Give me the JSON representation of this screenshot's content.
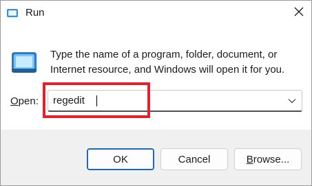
{
  "window": {
    "title": "Run",
    "close_icon": "close-icon",
    "app_icon": "run-icon"
  },
  "description": {
    "line1": "Type the name of a program, folder, document, or",
    "line2": "Internet resource, and Windows will open it for you."
  },
  "open_field": {
    "label_accesskey": "O",
    "label_rest": "pen:",
    "value": "regedit",
    "dropdown_icon": "chevron-down-icon"
  },
  "highlight": {
    "color": "#e5202b"
  },
  "buttons": {
    "ok_label": "OK",
    "cancel_label": "Cancel",
    "browse_accesskey": "B",
    "browse_rest": "rowse..."
  },
  "colors": {
    "default_button_border": "#1e66b8",
    "footer_bg": "#f0f0f0"
  }
}
